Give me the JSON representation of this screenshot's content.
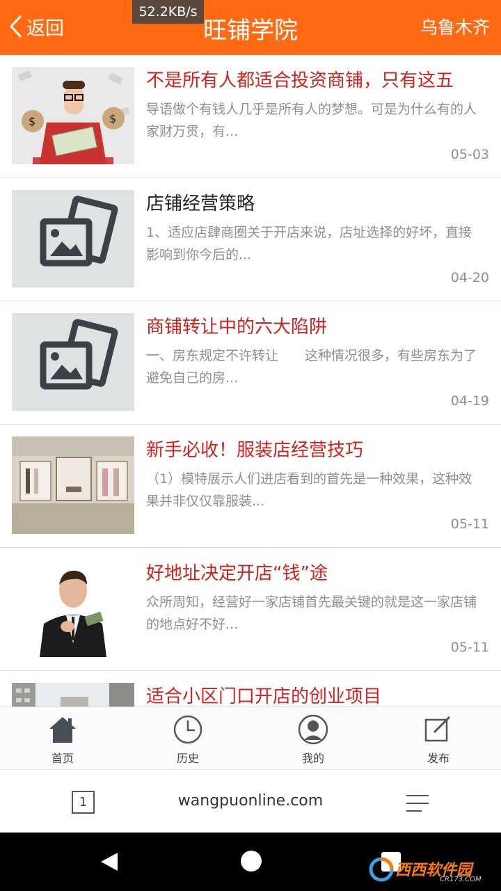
{
  "status": {
    "speed": "52.2KB/s"
  },
  "header": {
    "back_label": "返回",
    "title": "旺铺学院",
    "city": "乌鲁木齐"
  },
  "articles": [
    {
      "title": "不是所有人都适合投资商铺，只有这五",
      "desc": "导语做个有钱人几乎是所有人的梦想。可是为什么有的人家财万贯，有...",
      "date": "05-03",
      "title_color": "red",
      "thumb": "money-man-photo"
    },
    {
      "title": "店铺经营策略",
      "desc": "1、适应店肆商圈关于开店来说，店址选择的好坏，直接影响到你今后的...",
      "date": "04-20",
      "title_color": "black",
      "thumb": "image-placeholder-icon"
    },
    {
      "title": "商铺转让中的六大陷阱",
      "desc": "一、房东规定不许转让　　这种情况很多，有些房东为了避免自己的房...",
      "date": "04-19",
      "title_color": "red",
      "thumb": "image-placeholder-icon"
    },
    {
      "title": "新手必收！服装店经营技巧",
      "desc": "（1）模特展示人们进店看到的首先是一种效果，这种效果并非仅仅靠服装...",
      "date": "05-11",
      "title_color": "red",
      "thumb": "clothing-store-photo"
    },
    {
      "title": "好地址决定开店“钱”途",
      "desc": "众所周知，经营好一家店铺首先最关键的就是这一家店铺的地点好不好...",
      "date": "05-11",
      "title_color": "red",
      "thumb": "businessman-photo"
    },
    {
      "title": "适合小区门口开店的创业项目",
      "desc": "",
      "date": "",
      "title_color": "red",
      "thumb": "building-photo"
    }
  ],
  "tabbar": [
    {
      "label": "首页",
      "icon": "home-icon"
    },
    {
      "label": "历史",
      "icon": "clock-icon"
    },
    {
      "label": "我的",
      "icon": "user-icon"
    },
    {
      "label": "发布",
      "icon": "edit-icon"
    }
  ],
  "browser": {
    "tab_count": "1",
    "url": "wangpuonline.com"
  },
  "colors": {
    "accent": "#ff6a13",
    "title_red": "#d0211c",
    "meta_gray": "#8f8f8f"
  },
  "watermark": {
    "text": "西西软件园",
    "sub": "CR173.COM"
  }
}
